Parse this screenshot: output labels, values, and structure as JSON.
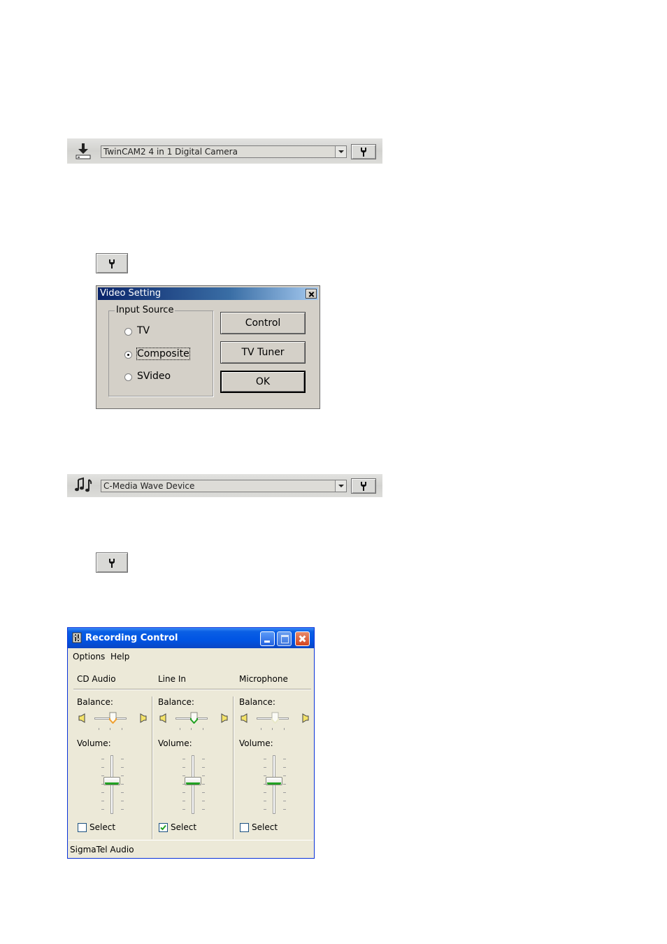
{
  "video_device_bar": {
    "icon": "download-icon",
    "selected_device": "TwinCAM2 4 in 1 Digital Camera",
    "settings_icon": "wrench-icon"
  },
  "video_settings_button": {
    "icon": "wrench-icon"
  },
  "video_setting_dialog": {
    "title": "Video Setting",
    "group_label": "Input Source",
    "radios": [
      {
        "label": "TV",
        "selected": false
      },
      {
        "label": "Composite",
        "selected": true
      },
      {
        "label": "SVideo",
        "selected": false
      }
    ],
    "buttons": {
      "control": "Control",
      "tv_tuner": "TV Tuner",
      "ok": "OK"
    }
  },
  "audio_device_bar": {
    "icon": "music-notes-icon",
    "selected_device": "C-Media Wave Device",
    "settings_icon": "wrench-icon"
  },
  "audio_settings_button": {
    "icon": "wrench-icon"
  },
  "recording_control": {
    "title": "Recording Control",
    "menu": [
      "Options",
      "Help"
    ],
    "columns": [
      {
        "name": "CD Audio",
        "balance_label": "Balance:",
        "volume_label": "Volume:",
        "select_label": "Select",
        "selected": false,
        "accent": "#f0a030"
      },
      {
        "name": "Line In",
        "balance_label": "Balance:",
        "volume_label": "Volume:",
        "select_label": "Select",
        "selected": true,
        "accent": "#21a121"
      },
      {
        "name": "Microphone",
        "balance_label": "Balance:",
        "volume_label": "Volume:",
        "select_label": "Select",
        "selected": false,
        "accent": "#e8e8c8"
      }
    ],
    "status": "SigmaTel Audio"
  },
  "colors": {
    "xp_title_blue": "#0054e3",
    "classic_title": "#0a246a",
    "dialog_face": "#d4d0c8",
    "xp_face": "#ece9d8"
  }
}
